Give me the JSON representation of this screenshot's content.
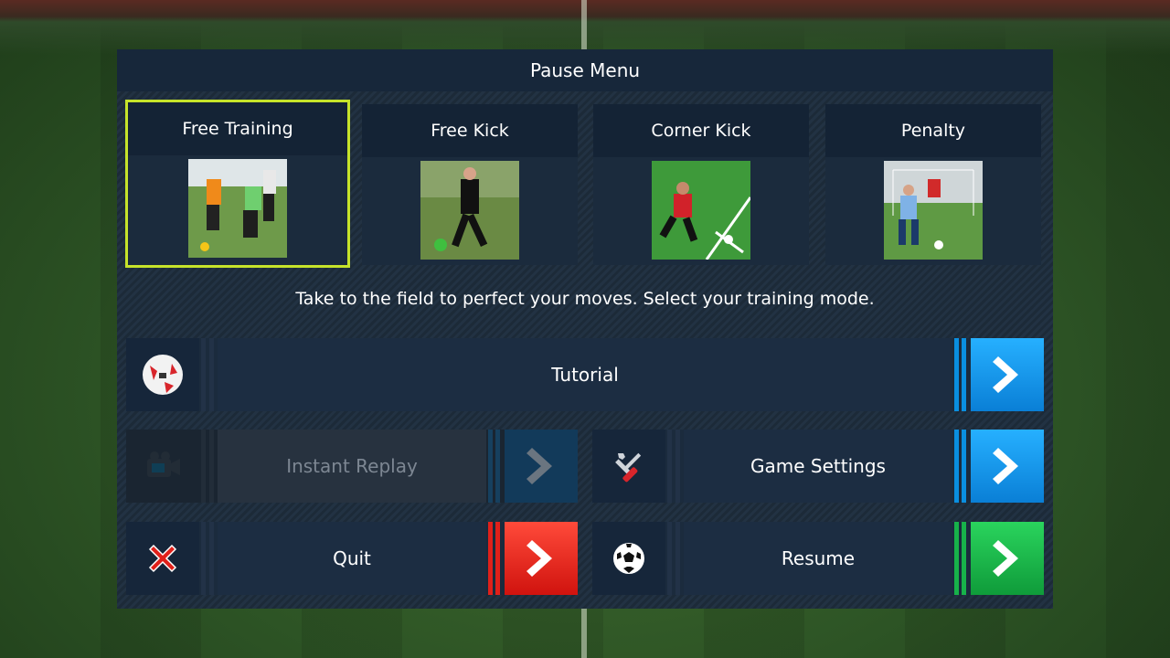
{
  "header": {
    "title": "Pause Menu"
  },
  "modes": [
    {
      "label": "Free Training",
      "selected": true
    },
    {
      "label": "Free Kick",
      "selected": false
    },
    {
      "label": "Corner Kick",
      "selected": false
    },
    {
      "label": "Penalty",
      "selected": false
    }
  ],
  "description": "Take to the field to perfect your moves. Select your training mode.",
  "buttons": {
    "tutorial": {
      "label": "Tutorial",
      "icon": "soccer-ball-icon",
      "accent": "#0a8fe0"
    },
    "instant_replay": {
      "label": "Instant Replay",
      "icon": "camera-icon",
      "accent": "#1a4d73",
      "enabled": false
    },
    "game_settings": {
      "label": "Game Settings",
      "icon": "tools-icon",
      "accent": "#0a8fe0"
    },
    "quit": {
      "label": "Quit",
      "icon": "close-icon",
      "accent": "#e0201a"
    },
    "resume": {
      "label": "Resume",
      "icon": "football-icon",
      "accent": "#17b24a"
    }
  },
  "colors": {
    "selected_outline": "#c6e32a",
    "panel": "#1b2b3d"
  }
}
